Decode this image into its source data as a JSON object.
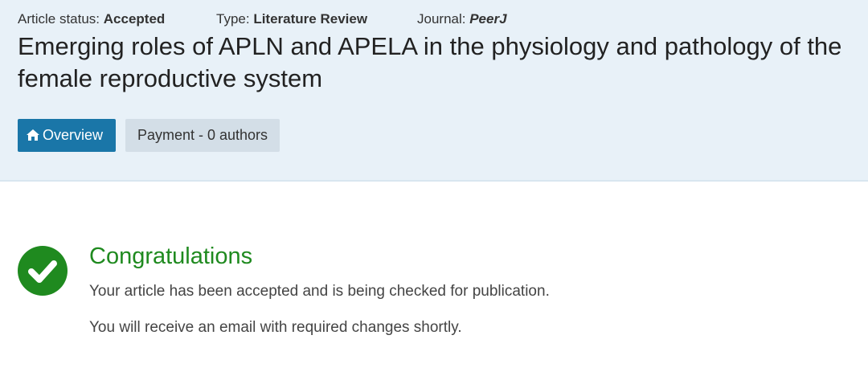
{
  "meta": {
    "status_label": "Article status:",
    "status_value": "Accepted",
    "type_label": "Type:",
    "type_value": "Literature Review",
    "journal_label": "Journal:",
    "journal_value": "PeerJ"
  },
  "article": {
    "title": "Emerging roles of APLN and APELA in the physiology and pathology of the female reproductive system"
  },
  "tabs": [
    {
      "label": "Overview",
      "icon": "home-icon",
      "active": true
    },
    {
      "label": "Payment - 0 authors",
      "active": false
    }
  ],
  "message": {
    "icon": "check-circle-icon",
    "title": "Congratulations",
    "line1": "Your article has been accepted and is being checked for publication.",
    "line2": "You will receive an email with required changes shortly."
  },
  "colors": {
    "header_bg": "#e8f1f8",
    "active_tab": "#1a76a8",
    "inactive_tab": "#d3dee7",
    "success_green": "#1f8a1f"
  }
}
